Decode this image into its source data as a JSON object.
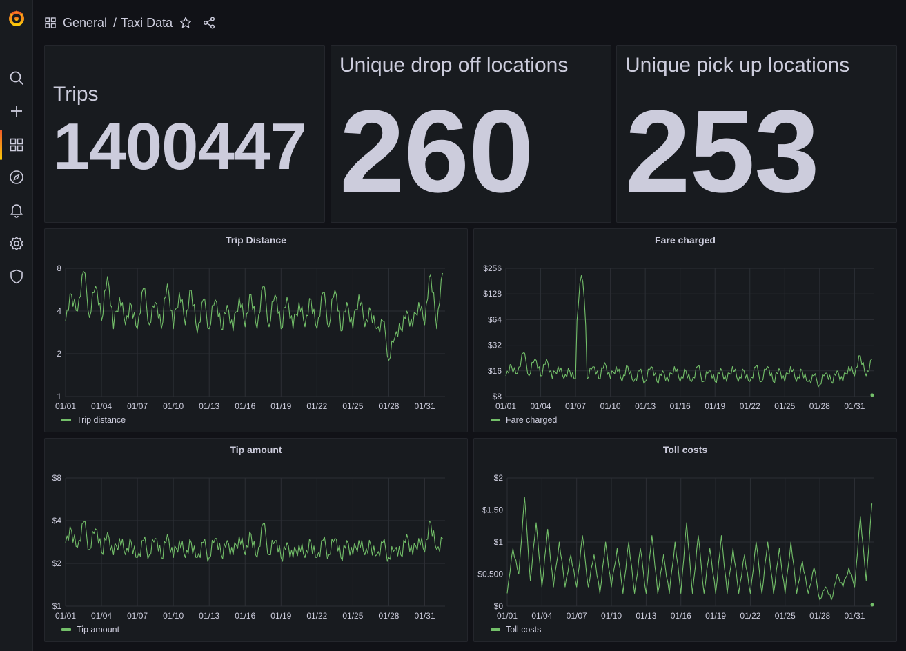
{
  "breadcrumb": {
    "folder": "General",
    "separator": "/",
    "dashboard": "Taxi Data"
  },
  "colors": {
    "series": "#73bf69",
    "accent_start": "#f05a28",
    "accent_end": "#fbca0a",
    "text": "#ccccdc"
  },
  "sidebar": {
    "items": [
      {
        "icon": "grafana-logo-icon"
      },
      {
        "icon": "search-icon"
      },
      {
        "icon": "plus-icon"
      },
      {
        "icon": "dashboards-icon",
        "active": true
      },
      {
        "icon": "explore-compass-icon"
      },
      {
        "icon": "alerting-bell-icon"
      },
      {
        "icon": "configuration-gear-icon"
      },
      {
        "icon": "server-admin-shield-icon"
      }
    ]
  },
  "stats": [
    {
      "title": "Trips",
      "value": "1400447"
    },
    {
      "title": "Unique drop off locations",
      "value": "260"
    },
    {
      "title": "Unique pick up locations",
      "value": "253"
    }
  ],
  "chart_data": [
    {
      "type": "line",
      "title": "Trip Distance",
      "legend": "Trip distance",
      "x_ticks": [
        "01/01",
        "01/04",
        "01/07",
        "01/10",
        "01/13",
        "01/16",
        "01/19",
        "01/22",
        "01/25",
        "01/28",
        "01/31"
      ],
      "y_ticks": [
        "1",
        "2",
        "4",
        "8"
      ],
      "y_scale": "log2",
      "ylim": [
        1,
        8
      ],
      "x": [
        1,
        1.5,
        2,
        2.5,
        3,
        3.5,
        4,
        4.5,
        5,
        5.5,
        6,
        6.5,
        7,
        7.5,
        8,
        8.5,
        9,
        9.5,
        10,
        10.5,
        11,
        11.5,
        12,
        12.5,
        13,
        13.5,
        14,
        14.5,
        15,
        15.5,
        16,
        16.5,
        17,
        17.5,
        18,
        18.5,
        19,
        19.5,
        20,
        20.5,
        21,
        21.5,
        22,
        22.5,
        23,
        23.5,
        24,
        24.5,
        25,
        25.5,
        26,
        26.5,
        27,
        27.5,
        28,
        28.5,
        29,
        29.5,
        30,
        30.5,
        31,
        31.5,
        32,
        32.5
      ],
      "values": [
        3.4,
        5.2,
        4.0,
        7.6,
        3.6,
        6.0,
        3.4,
        7.0,
        3.0,
        5.0,
        3.2,
        4.4,
        3.0,
        5.8,
        3.2,
        4.6,
        3.0,
        6.2,
        3.0,
        5.4,
        3.2,
        5.6,
        2.8,
        4.8,
        3.0,
        4.8,
        3.0,
        4.4,
        2.9,
        5.0,
        3.1,
        5.2,
        3.0,
        6.0,
        3.1,
        5.2,
        3.0,
        5.0,
        3.0,
        4.6,
        3.1,
        4.8,
        3.0,
        5.4,
        3.1,
        5.6,
        2.9,
        4.6,
        3.0,
        5.2,
        3.1,
        4.0,
        3.0,
        3.4,
        1.8,
        2.6,
        3.0,
        4.0,
        3.1,
        4.6,
        3.2,
        7.2,
        3.0,
        7.4
      ]
    },
    {
      "type": "line",
      "title": "Fare charged",
      "legend": "Fare charged",
      "x_ticks": [
        "01/01",
        "01/04",
        "01/07",
        "01/10",
        "01/13",
        "01/16",
        "01/19",
        "01/22",
        "01/25",
        "01/28",
        "01/31"
      ],
      "y_ticks": [
        "$8",
        "$16",
        "$32",
        "$64",
        "$128",
        "$256"
      ],
      "y_scale": "log2",
      "ylim": [
        8,
        256
      ],
      "x": [
        1,
        1.5,
        2,
        2.5,
        3,
        3.5,
        4,
        4.5,
        5,
        5.5,
        6,
        6.5,
        7,
        7.5,
        8,
        8.5,
        9,
        9.5,
        10,
        10.5,
        11,
        11.5,
        12,
        12.5,
        13,
        13.5,
        14,
        14.5,
        15,
        15.5,
        16,
        16.5,
        17,
        17.5,
        18,
        18.5,
        19,
        19.5,
        20,
        20.5,
        21,
        21.5,
        22,
        22.5,
        23,
        23.5,
        24,
        24.5,
        25,
        25.5,
        26,
        26.5,
        27,
        27.5,
        28,
        28.5,
        29,
        29.5,
        30,
        30.5,
        31,
        31.5,
        32,
        32.5
      ],
      "values": [
        14,
        18,
        15,
        26,
        14,
        22,
        14,
        22,
        13,
        18,
        13,
        16,
        13,
        210,
        13,
        18,
        13,
        20,
        13,
        18,
        12,
        18,
        12,
        16,
        12,
        18,
        12,
        16,
        12,
        18,
        12,
        16,
        12,
        18,
        12,
        16,
        12,
        17,
        12,
        18,
        12,
        16,
        12,
        18,
        12,
        18,
        12,
        17,
        12,
        18,
        12,
        16,
        12,
        14,
        11,
        15,
        12,
        16,
        12,
        18,
        14,
        24,
        14,
        22
      ]
    },
    {
      "type": "line",
      "title": "Tip amount",
      "legend": "Tip amount",
      "x_ticks": [
        "01/01",
        "01/04",
        "01/07",
        "01/10",
        "01/13",
        "01/16",
        "01/19",
        "01/22",
        "01/25",
        "01/28",
        "01/31"
      ],
      "y_ticks": [
        "$1",
        "$2",
        "$4",
        "$8"
      ],
      "y_scale": "log2",
      "ylim": [
        1,
        8
      ],
      "x": [
        1,
        1.5,
        2,
        2.5,
        3,
        3.5,
        4,
        4.5,
        5,
        5.5,
        6,
        6.5,
        7,
        7.5,
        8,
        8.5,
        9,
        9.5,
        10,
        10.5,
        11,
        11.5,
        12,
        12.5,
        13,
        13.5,
        14,
        14.5,
        15,
        15.5,
        16,
        16.5,
        17,
        17.5,
        18,
        18.5,
        19,
        19.5,
        20,
        20.5,
        21,
        21.5,
        22,
        22.5,
        23,
        23.5,
        24,
        24.5,
        25,
        25.5,
        26,
        26.5,
        27,
        27.5,
        28,
        28.5,
        29,
        29.5,
        30,
        30.5,
        31,
        31.5,
        32,
        32.5
      ],
      "values": [
        2.8,
        3.4,
        2.6,
        3.9,
        2.5,
        3.5,
        2.4,
        3.3,
        2.3,
        3.0,
        2.3,
        2.8,
        2.2,
        2.9,
        2.3,
        3.0,
        2.2,
        3.2,
        2.2,
        2.9,
        2.2,
        2.8,
        2.2,
        2.8,
        2.2,
        3.0,
        2.3,
        2.9,
        2.3,
        3.1,
        2.3,
        3.2,
        2.2,
        3.8,
        2.3,
        2.9,
        2.2,
        2.8,
        2.2,
        2.7,
        2.2,
        2.8,
        2.2,
        2.9,
        2.3,
        3.0,
        2.2,
        2.9,
        2.3,
        2.9,
        2.3,
        2.7,
        2.3,
        2.8,
        2.2,
        2.5,
        2.3,
        3.2,
        2.3,
        3.0,
        2.4,
        3.9,
        2.5,
        3.0
      ]
    },
    {
      "type": "line",
      "title": "Toll costs",
      "legend": "Toll costs",
      "x_ticks": [
        "01/01",
        "01/04",
        "01/07",
        "01/10",
        "01/13",
        "01/16",
        "01/19",
        "01/22",
        "01/25",
        "01/28",
        "01/31"
      ],
      "y_ticks": [
        "$0",
        "$0.500",
        "$1",
        "$1.50",
        "$2"
      ],
      "y_scale": "linear",
      "ylim": [
        0,
        2
      ],
      "x": [
        1,
        1.5,
        2,
        2.5,
        3,
        3.5,
        4,
        4.5,
        5,
        5.5,
        6,
        6.5,
        7,
        7.5,
        8,
        8.5,
        9,
        9.5,
        10,
        10.5,
        11,
        11.5,
        12,
        12.5,
        13,
        13.5,
        14,
        14.5,
        15,
        15.5,
        16,
        16.5,
        17,
        17.5,
        18,
        18.5,
        19,
        19.5,
        20,
        20.5,
        21,
        21.5,
        22,
        22.5,
        23,
        23.5,
        24,
        24.5,
        25,
        25.5,
        26,
        26.5,
        27,
        27.5,
        28,
        28.5,
        29,
        29.5,
        30,
        30.5,
        31,
        31.5,
        32,
        32.5
      ],
      "values": [
        0.2,
        0.9,
        0.5,
        1.7,
        0.4,
        1.3,
        0.3,
        1.2,
        0.3,
        1.0,
        0.3,
        0.8,
        0.3,
        1.1,
        0.3,
        0.8,
        0.2,
        1.0,
        0.3,
        0.9,
        0.2,
        1.0,
        0.2,
        0.9,
        0.2,
        1.1,
        0.2,
        0.8,
        0.2,
        1.0,
        0.2,
        1.3,
        0.2,
        1.1,
        0.2,
        0.9,
        0.2,
        1.1,
        0.2,
        0.9,
        0.2,
        0.8,
        0.2,
        1.0,
        0.2,
        1.0,
        0.2,
        0.9,
        0.2,
        1.0,
        0.2,
        0.7,
        0.2,
        0.6,
        0.1,
        0.3,
        0.1,
        0.5,
        0.3,
        0.6,
        0.3,
        1.4,
        0.4,
        1.6
      ]
    }
  ]
}
